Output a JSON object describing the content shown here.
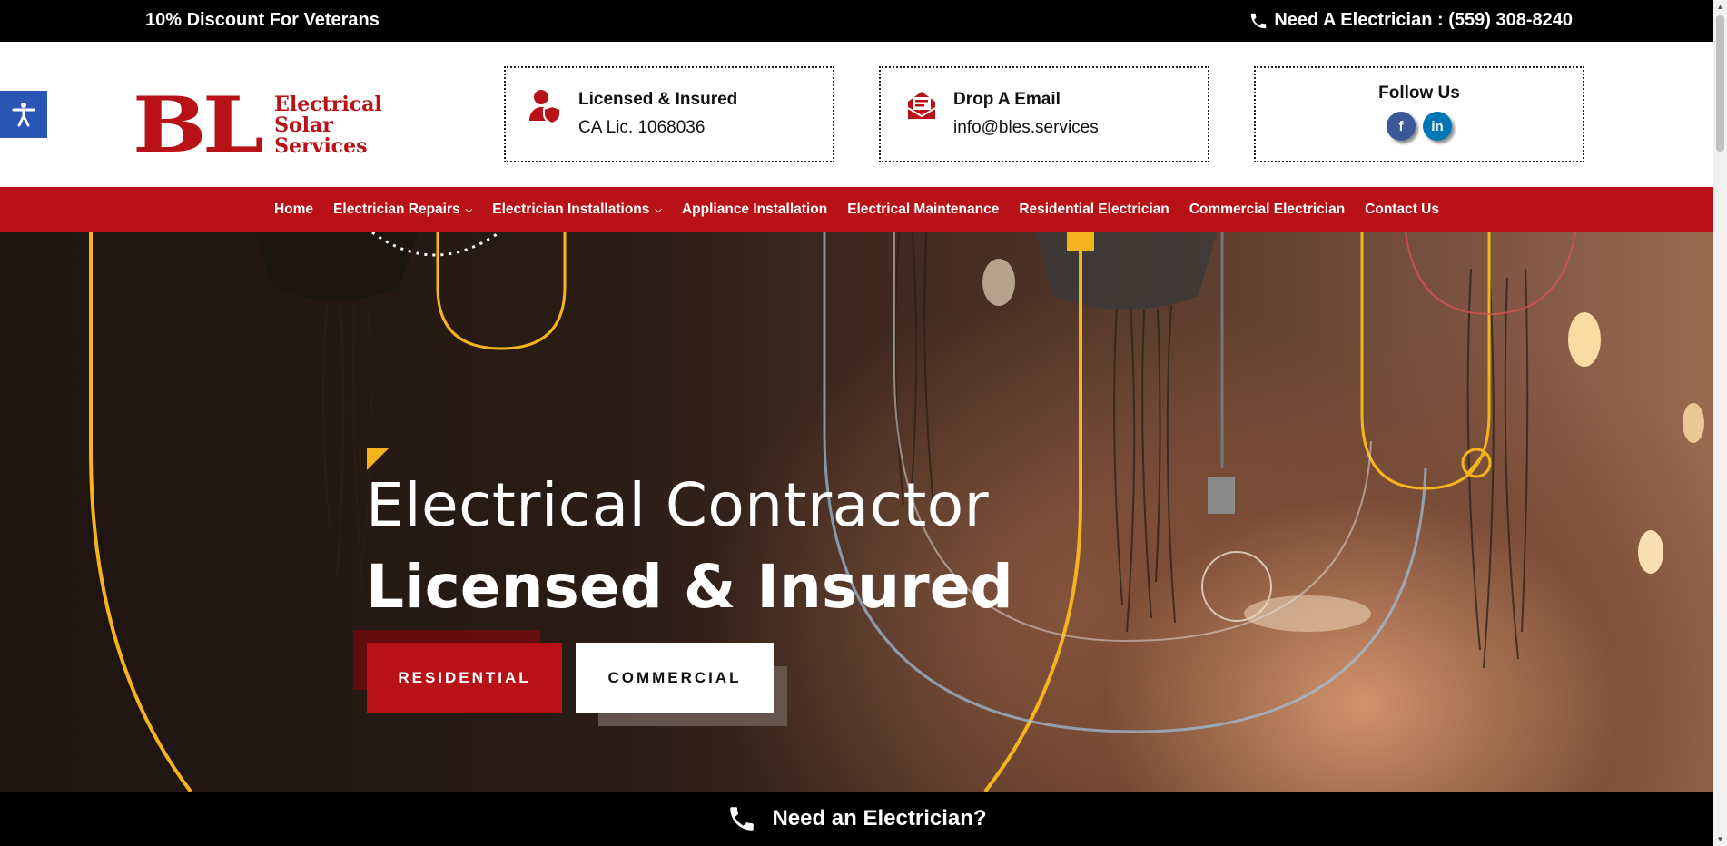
{
  "topbar": {
    "promo": "10% Discount For Veterans",
    "phone_label": "Need A Electrician : (559) 308-8240",
    "phone_icon": "phone-icon"
  },
  "header": {
    "logo": {
      "letters": "BL",
      "line1": "Electrical",
      "line2": "Solar",
      "line3": "Services"
    },
    "license": {
      "title": "Licensed & Insured",
      "value": "CA Lic. 1068036",
      "icon": "user-shield-icon"
    },
    "email": {
      "title": "Drop A Email",
      "value": "info@bles.services",
      "icon": "envelope-icon"
    },
    "follow": {
      "title": "Follow Us",
      "facebook": "f",
      "linkedin": "in"
    }
  },
  "nav": {
    "items": [
      {
        "label": "Home"
      },
      {
        "label": "Electrician Repairs",
        "dropdown": true
      },
      {
        "label": "Electrician Installations",
        "dropdown": true
      },
      {
        "label": "Appliance Installation"
      },
      {
        "label": "Electrical Maintenance"
      },
      {
        "label": "Residential Electrician"
      },
      {
        "label": "Commercial Electrician"
      },
      {
        "label": "Contact Us"
      }
    ]
  },
  "hero": {
    "heading_line1": "Electrical Contractor",
    "heading_line2": "Licensed & Insured",
    "btn_residential": "RESIDENTIAL",
    "btn_commercial": "COMMERCIAL"
  },
  "bottombar": {
    "label": "Need an Electrician?",
    "icon": "phone-icon"
  },
  "colors": {
    "brand_red": "#b81117",
    "accent_yellow": "#f5b41e",
    "a11y_blue": "#2a55b5"
  }
}
